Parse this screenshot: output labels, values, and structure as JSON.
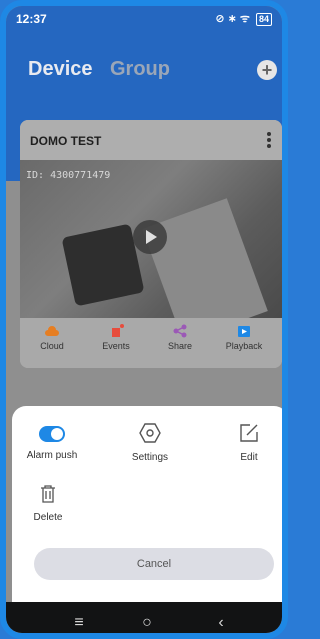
{
  "status": {
    "time": "12:37",
    "icons_text": "⊘ ∗ ᯤ",
    "battery": "84"
  },
  "header": {
    "title": "Device",
    "tab_group": "Group"
  },
  "device_card": {
    "name": "DOMO TEST",
    "osd_id": "ID: 4300771479",
    "actions": [
      {
        "label": "Cloud",
        "icon": "cloud-icon",
        "color": "#e67e22"
      },
      {
        "label": "Events",
        "icon": "siren-icon",
        "color": "#e74c3c"
      },
      {
        "label": "Share",
        "icon": "share-icon",
        "color": "#9b59b6"
      },
      {
        "label": "Playback",
        "icon": "playback-icon",
        "color": "#1e88e5"
      }
    ]
  },
  "sheet": {
    "alarm_push": {
      "label": "Alarm push",
      "enabled": true
    },
    "settings": {
      "label": "Settings"
    },
    "edit": {
      "label": "Edit"
    },
    "delete": {
      "label": "Delete"
    },
    "cancel": "Cancel"
  },
  "navbar": {
    "menu_icon": "≡",
    "home_icon": "○",
    "back_icon": "‹"
  },
  "colors": {
    "accent": "#1e88e5",
    "header_bg": "#2567c0"
  }
}
